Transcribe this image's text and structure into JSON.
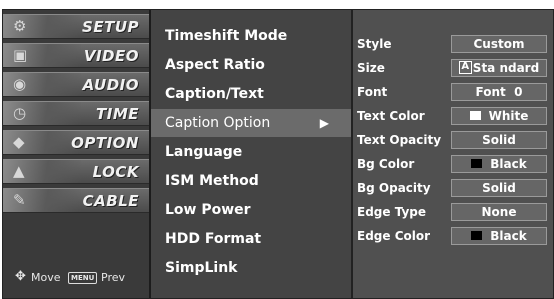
{
  "main_menu": {
    "items": [
      {
        "label": "SETUP",
        "icon": "setup-icon"
      },
      {
        "label": "VIDEO",
        "icon": "video-icon"
      },
      {
        "label": "AUDIO",
        "icon": "audio-icon"
      },
      {
        "label": "TIME",
        "icon": "clock-icon"
      },
      {
        "label": "OPTION",
        "icon": "option-icon"
      },
      {
        "label": "LOCK",
        "icon": "lock-icon"
      },
      {
        "label": "CABLE",
        "icon": "cable-icon"
      }
    ],
    "footer": {
      "move_label": "Move",
      "menu_key": "MENU",
      "prev_label": "Prev"
    }
  },
  "submenu": {
    "items": [
      {
        "label": "Timeshift Mode"
      },
      {
        "label": "Aspect Ratio"
      },
      {
        "label": "Caption/Text"
      },
      {
        "label": "Caption Option",
        "selected": true
      },
      {
        "label": "Language"
      },
      {
        "label": "ISM Method"
      },
      {
        "label": "Low Power"
      },
      {
        "label": "HDD Format"
      },
      {
        "label": "SimpLink"
      }
    ],
    "selected_arrow": "▶"
  },
  "caption_options": {
    "rows": [
      {
        "label": "Style",
        "value": "Custom"
      },
      {
        "label": "Size",
        "value": "Sta ndard",
        "badge": "A"
      },
      {
        "label": "Font",
        "value": "Font  0"
      },
      {
        "label": "Text Color",
        "value": "White",
        "swatch": "#ffffff"
      },
      {
        "label": "Text Opacity",
        "value": "Solid"
      },
      {
        "label": "Bg Color",
        "value": "Black",
        "swatch": "#000000"
      },
      {
        "label": "Bg Opacity",
        "value": "Solid"
      },
      {
        "label": "Edge Type",
        "value": "None"
      },
      {
        "label": "Edge Color",
        "value": "Black",
        "swatch": "#000000"
      }
    ]
  },
  "colors": {
    "background": "#3c3c3c",
    "selected_row": "#6b6b6b",
    "value_box": "#666666"
  }
}
